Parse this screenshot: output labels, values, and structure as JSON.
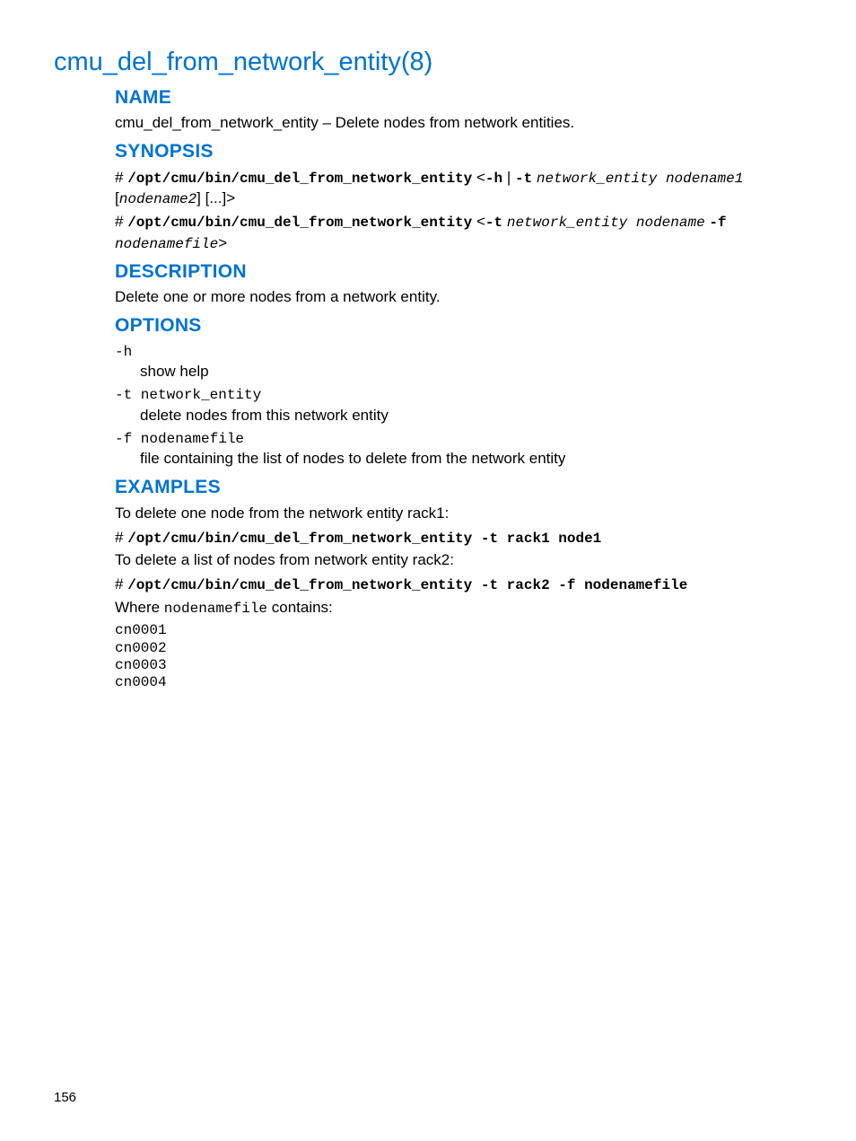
{
  "page": {
    "title": "cmu_del_from_network_entity(8)",
    "number": "156"
  },
  "name": {
    "heading": "NAME",
    "text": "cmu_del_from_network_entity – Delete nodes from network entities."
  },
  "synopsis": {
    "heading": "SYNOPSIS",
    "line1": {
      "hash": "# ",
      "cmd": "/opt/cmu/bin/cmu_del_from_network_entity",
      "lt": " <",
      "h": "-h",
      "pipe": " | ",
      "t": "-t",
      "space": " ",
      "arg1": "network_entity nodename1",
      "br_open": " [",
      "arg2": "nodename2",
      "br_close": "] [...]>"
    },
    "line2": {
      "hash": "# ",
      "cmd": "/opt/cmu/bin/cmu_del_from_network_entity",
      "lt": " <",
      "t": "-t",
      "space": " ",
      "arg1": "network_entity nodename",
      "space2": " ",
      "f": "-f",
      "space3": " ",
      "arg2": "nodenamefile",
      "gt": ">"
    }
  },
  "description": {
    "heading": "DESCRIPTION",
    "text": "Delete one or more nodes from a network entity."
  },
  "options": {
    "heading": "OPTIONS",
    "items": [
      {
        "term": "-h",
        "desc": "show help"
      },
      {
        "term": "-t network_entity",
        "desc": "delete nodes from this network entity"
      },
      {
        "term": "-f nodenamefile",
        "desc": "file containing the list of nodes to delete from the network entity"
      }
    ]
  },
  "examples": {
    "heading": "EXAMPLES",
    "intro1": "To delete one node from the network entity rack1:",
    "cmd1_hash": "# ",
    "cmd1": "/opt/cmu/bin/cmu_del_from_network_entity -t rack1 node1",
    "intro2": "To delete a list of nodes from network entity rack2:",
    "cmd2_hash": "# ",
    "cmd2": "/opt/cmu/bin/cmu_del_from_network_entity -t rack2 -f nodenamefile",
    "where_pre": "Where ",
    "where_code": "nodenamefile",
    "where_post": " contains:",
    "file": "cn0001\ncn0002\ncn0003\ncn0004"
  }
}
